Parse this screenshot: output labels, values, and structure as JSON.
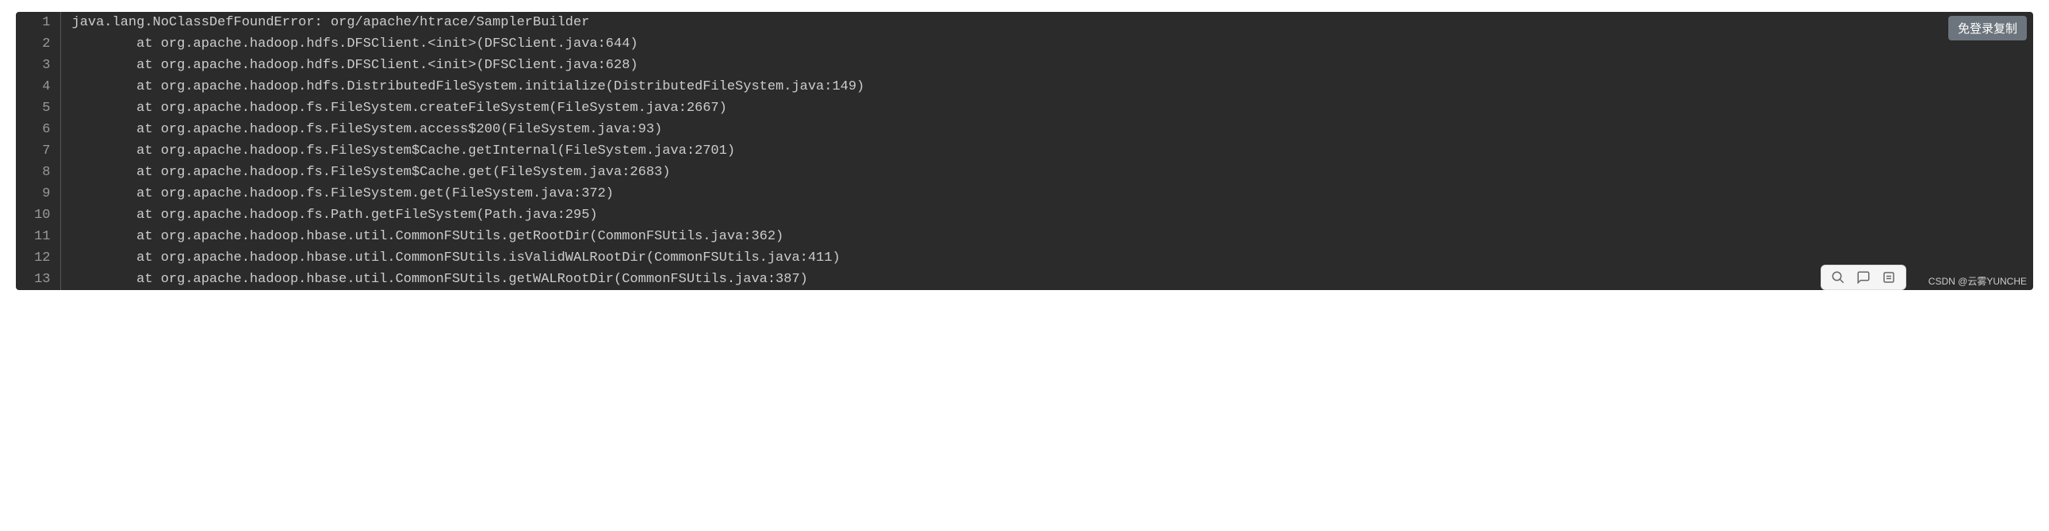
{
  "copy_button_label": "免登录复制",
  "watermark_text": "CSDN @云雾YUNCHE",
  "code_lines": [
    "java.lang.NoClassDefFoundError: org/apache/htrace/SamplerBuilder",
    "        at org.apache.hadoop.hdfs.DFSClient.<init>(DFSClient.java:644)",
    "        at org.apache.hadoop.hdfs.DFSClient.<init>(DFSClient.java:628)",
    "        at org.apache.hadoop.hdfs.DistributedFileSystem.initialize(DistributedFileSystem.java:149)",
    "        at org.apache.hadoop.fs.FileSystem.createFileSystem(FileSystem.java:2667)",
    "        at org.apache.hadoop.fs.FileSystem.access$200(FileSystem.java:93)",
    "        at org.apache.hadoop.fs.FileSystem$Cache.getInternal(FileSystem.java:2701)",
    "        at org.apache.hadoop.fs.FileSystem$Cache.get(FileSystem.java:2683)",
    "        at org.apache.hadoop.fs.FileSystem.get(FileSystem.java:372)",
    "        at org.apache.hadoop.fs.Path.getFileSystem(Path.java:295)",
    "        at org.apache.hadoop.hbase.util.CommonFSUtils.getRootDir(CommonFSUtils.java:362)",
    "        at org.apache.hadoop.hbase.util.CommonFSUtils.isValidWALRootDir(CommonFSUtils.java:411)",
    "        at org.apache.hadoop.hbase.util.CommonFSUtils.getWALRootDir(CommonFSUtils.java:387)"
  ]
}
